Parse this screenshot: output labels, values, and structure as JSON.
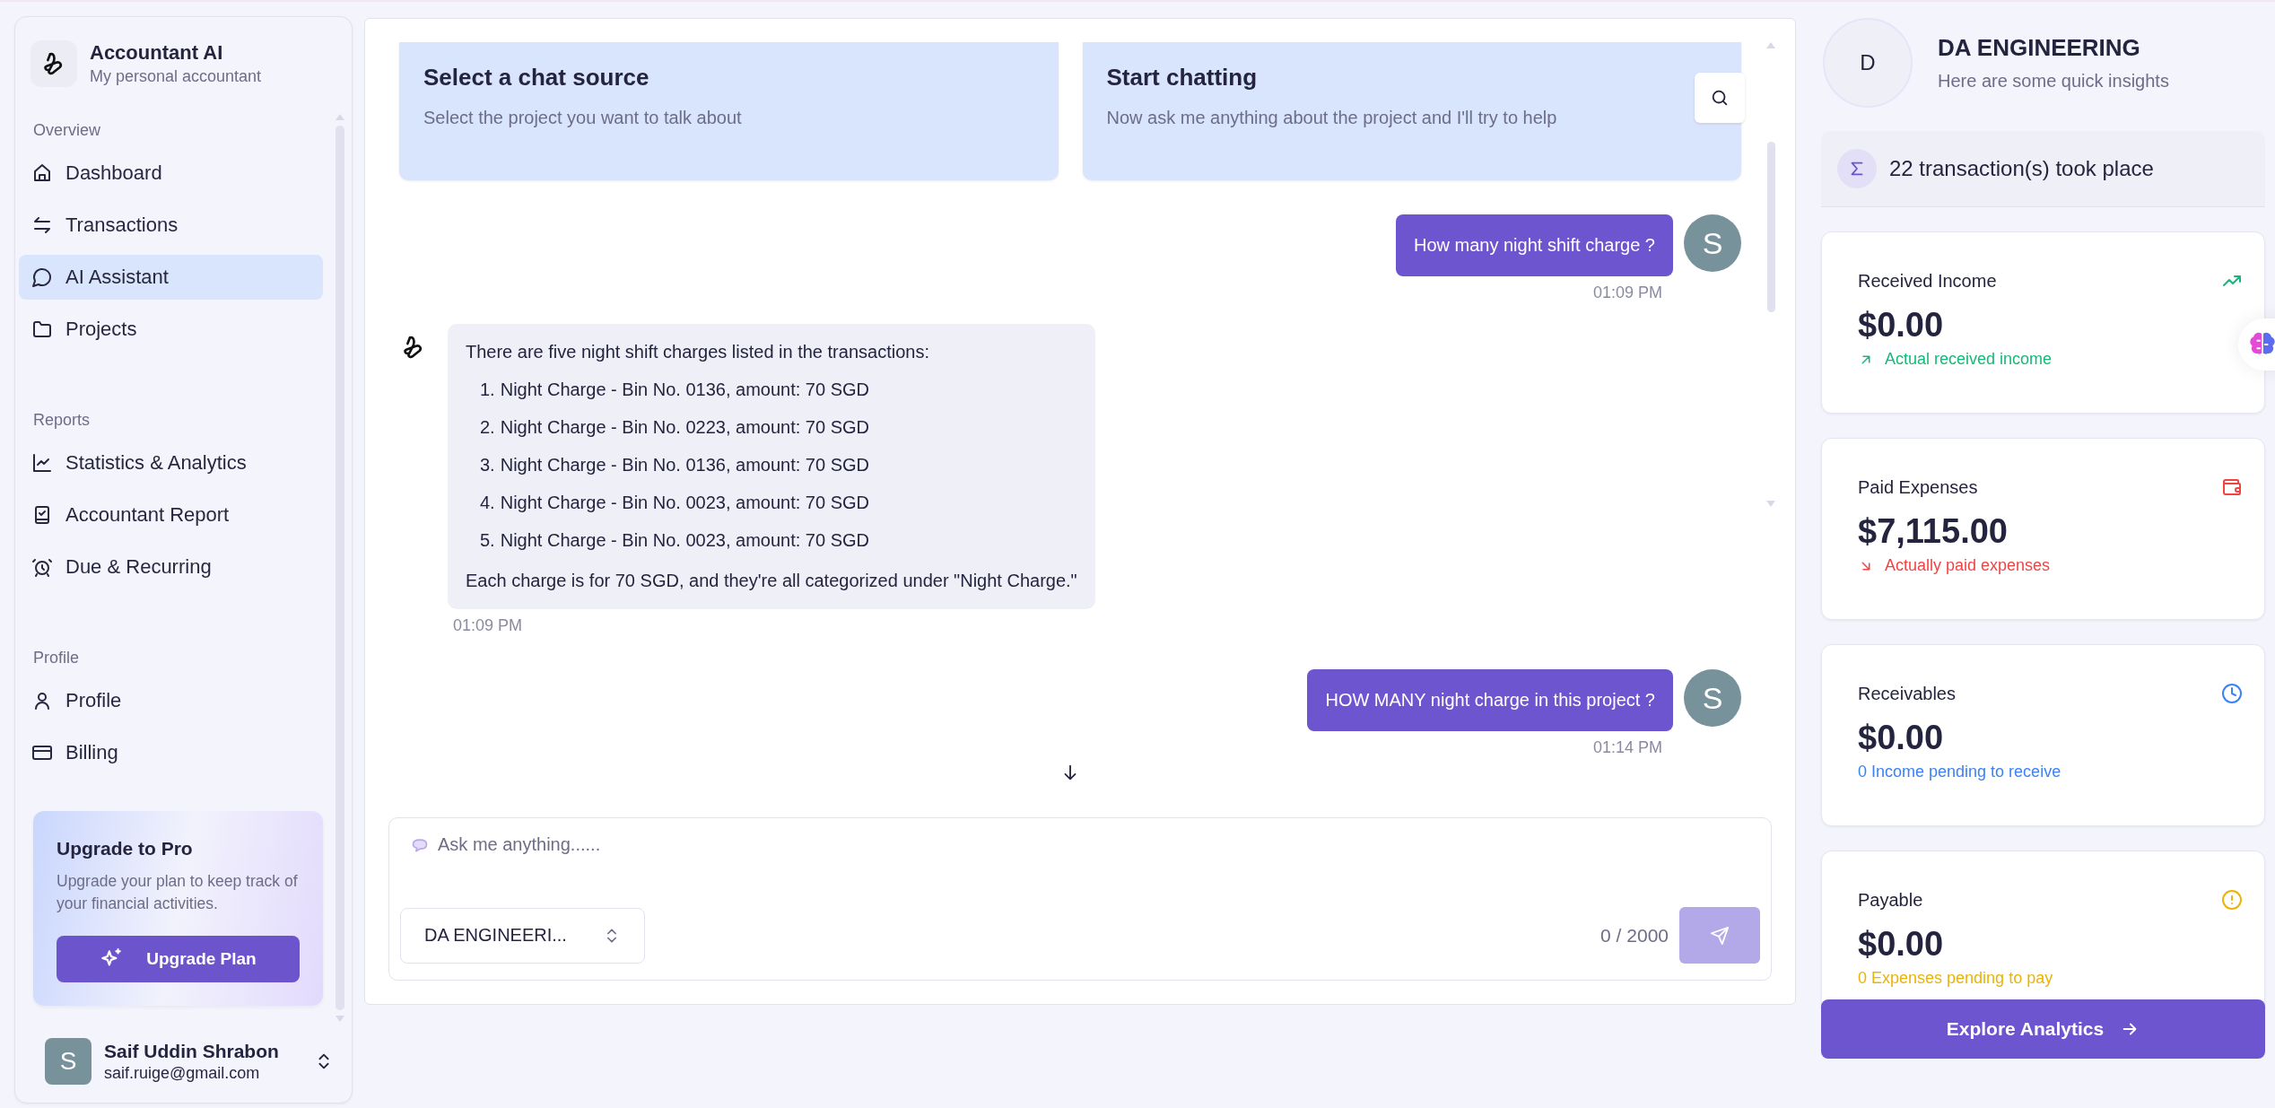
{
  "app": {
    "name": "Accountant AI",
    "tagline": "My personal accountant"
  },
  "sidebar": {
    "sections": [
      {
        "heading": "Overview",
        "items": [
          {
            "label": "Dashboard",
            "selected": false
          },
          {
            "label": "Transactions",
            "selected": false
          },
          {
            "label": "AI Assistant",
            "selected": true
          },
          {
            "label": "Projects",
            "selected": false
          }
        ]
      },
      {
        "heading": "Reports",
        "items": [
          {
            "label": "Statistics & Analytics",
            "selected": false
          },
          {
            "label": "Accountant Report",
            "selected": false
          },
          {
            "label": "Due & Recurring",
            "selected": false
          }
        ]
      },
      {
        "heading": "Profile",
        "items": [
          {
            "label": "Profile",
            "selected": false
          },
          {
            "label": "Billing",
            "selected": false
          }
        ]
      }
    ]
  },
  "upgrade": {
    "title": "Upgrade to Pro",
    "text": "Upgrade your plan to keep track of your financial activities.",
    "button": "Upgrade Plan"
  },
  "user": {
    "initial": "S",
    "name": "Saif Uddin Shrabon",
    "email": "saif.ruige@gmail.com"
  },
  "intro_cards": [
    {
      "title": "Select a chat source",
      "text": "Select the project you want to talk about"
    },
    {
      "title": "Start chatting",
      "text": "Now ask me anything about the project and I'll try to help"
    }
  ],
  "messages": [
    {
      "kind": "user",
      "text": "How many night shift charge ?",
      "time": "01:09 PM",
      "initial": "S"
    },
    {
      "kind": "bot",
      "intro": "There are five night shift charges listed in the transactions:",
      "items": [
        {
          "number": "1.",
          "text": "Night Charge - Bin No. 0136, amount: 70 SGD"
        },
        {
          "number": "2.",
          "text": "Night Charge - Bin No. 0223, amount: 70 SGD"
        },
        {
          "number": "3.",
          "text": "Night Charge - Bin No. 0136, amount: 70 SGD"
        },
        {
          "number": "4.",
          "text": "Night Charge - Bin No. 0023, amount: 70 SGD"
        },
        {
          "number": "5.",
          "text": "Night Charge - Bin No. 0023, amount: 70 SGD"
        }
      ],
      "outro": "Each charge is for 70 SGD, and they're all categorized under \"Night Charge.\"",
      "time": "01:09 PM"
    },
    {
      "kind": "user",
      "text": "HOW MANY night charge in this project ?",
      "time": "01:14 PM",
      "initial": "S"
    }
  ],
  "composer": {
    "placeholder": "Ask me anything......",
    "project": "DA ENGINEERI...",
    "counter": "0 / 2000",
    "send_disabled": true
  },
  "insights": {
    "initial": "D",
    "title": "DA ENGINEERING",
    "subtitle": "Here are some quick insights",
    "summary": "22 transaction(s) took place",
    "cards": [
      {
        "kind": "income",
        "title": "Received Income",
        "amount": "$0.00",
        "note": "Actual received income",
        "color": "#16b87a"
      },
      {
        "kind": "expense",
        "title": "Paid Expenses",
        "amount": "$7,115.00",
        "note": "Actually paid expenses",
        "color": "#ef4444"
      },
      {
        "kind": "receivable",
        "title": "Receivables",
        "amount": "$0.00",
        "note": "0 Income pending to receive",
        "color": "#3b82f6"
      },
      {
        "kind": "payable",
        "title": "Payable",
        "amount": "$0.00",
        "note": "0 Expenses pending to pay",
        "color": "#eab308"
      }
    ],
    "button": "Explore Analytics"
  }
}
